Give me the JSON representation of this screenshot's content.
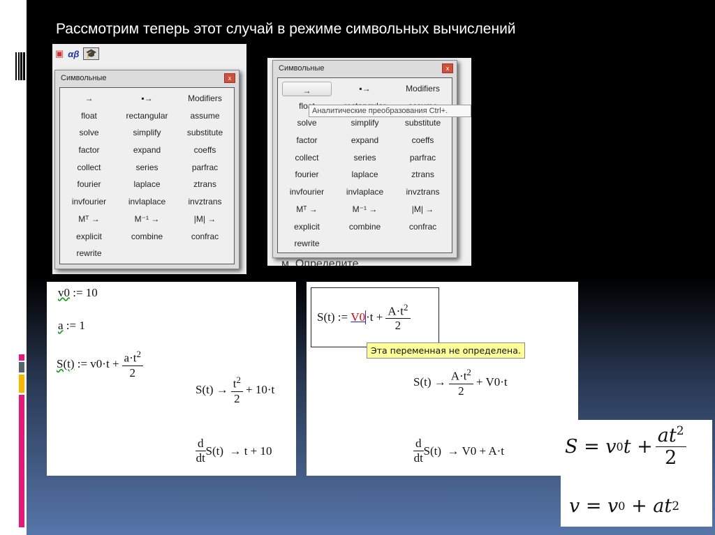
{
  "slide_title": "Рассмотрим теперь этот случай в режиме символьных вычислений",
  "accent_colors": {
    "pink": "#e5197a",
    "gray": "#5a6470",
    "orange": "#f5b800"
  },
  "toolbar": {
    "icons": [
      "matrix-icon",
      "greek-alphabet-icon",
      "symbolic-cap-icon"
    ],
    "greek_label": "αβ"
  },
  "palette": {
    "title": "Символьные",
    "close": "x",
    "items": [
      "→",
      "▪→",
      "Modifiers",
      "float",
      "rectangular",
      "assume",
      "solve",
      "simplify",
      "substitute",
      "factor",
      "expand",
      "coeffs",
      "collect",
      "series",
      "parfrac",
      "fourier",
      "laplace",
      "ztrans",
      "invfourier",
      "invlaplace",
      "invztrans",
      "Mᵀ →",
      "M⁻¹ →",
      "|M| →",
      "explicit",
      "combine",
      "confrac",
      "rewrite"
    ]
  },
  "tooltip": "Аналитические преобразования Ctrl+.",
  "behind_text": "м. Определите",
  "worksheet1": {
    "v0_def": [
      "v0",
      ":= 10"
    ],
    "a_def": [
      "a",
      ":= 1"
    ],
    "s_def": {
      "lhs": "S(t)",
      "mid": ":= v0·t +",
      "num": "a·t",
      "exp": "2",
      "den": "2"
    },
    "s_eval": {
      "lhs": "S(t) →",
      "num": "t",
      "exp": "2",
      "den": "2",
      "rest": "+ 10·t"
    },
    "d_eval": {
      "d": "d",
      "dt": "dt",
      "fn": "S(t)",
      "result": "→ t + 10"
    }
  },
  "worksheet2": {
    "s_def": {
      "lhs": "S(t) :=",
      "var": "V0",
      "mid": "·t +",
      "num": "A·t",
      "exp": "2",
      "den": "2"
    },
    "error": "Эта переменная не определена.",
    "s_eval": {
      "lhs": "S(t) →",
      "num": "A·t",
      "exp": "2",
      "den": "2",
      "rest": "+ V0·t"
    },
    "d_eval": {
      "d": "d",
      "dt": "dt",
      "fn": "S(t)",
      "result": "→ V0 + A·t"
    }
  },
  "formulas": {
    "s_lhs": "S = v",
    "s_sub": "0",
    "s_t": "t +",
    "s_num": "at",
    "s_exp": "2",
    "s_den": "2",
    "v_lhs": "v = v",
    "v_sub": "0",
    "v_rest": "+ at",
    "v_exp": "2"
  }
}
